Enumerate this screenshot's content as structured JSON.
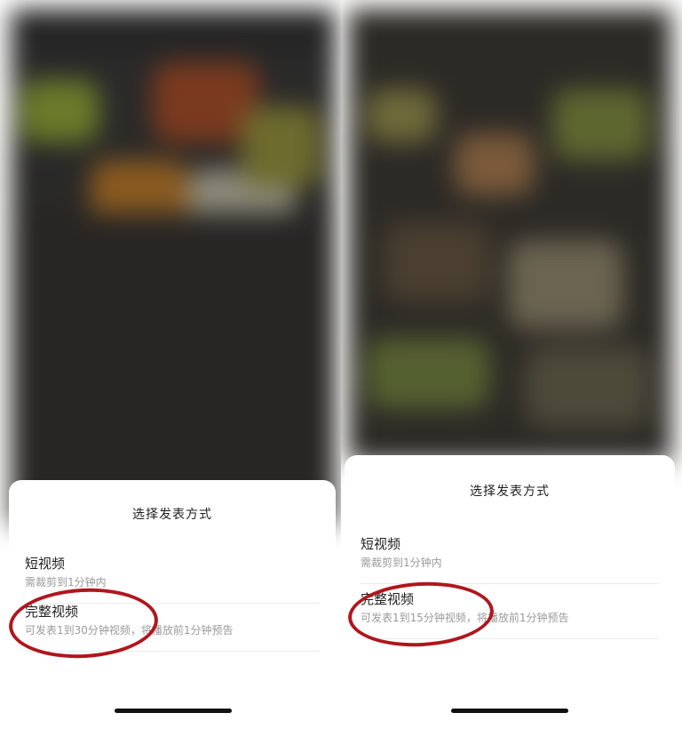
{
  "left_panel": {
    "sheet_title": "选择发表方式",
    "options": [
      {
        "title": "短视频",
        "description": "需裁剪到1分钟内"
      },
      {
        "title": "完整视频",
        "description": "可发表1到30分钟视频，将播放前1分钟预告"
      }
    ]
  },
  "right_panel": {
    "sheet_title": "选择发表方式",
    "options": [
      {
        "title": "短视频",
        "description": "需裁剪到1分钟内"
      },
      {
        "title": "完整视频",
        "description": "可发表1到15分钟视频，将播放前1分钟预告"
      }
    ]
  },
  "colors": {
    "annotation_ring": "#b0161d",
    "sheet_bg": "#ffffff",
    "desc_text": "#9a9a9a"
  }
}
